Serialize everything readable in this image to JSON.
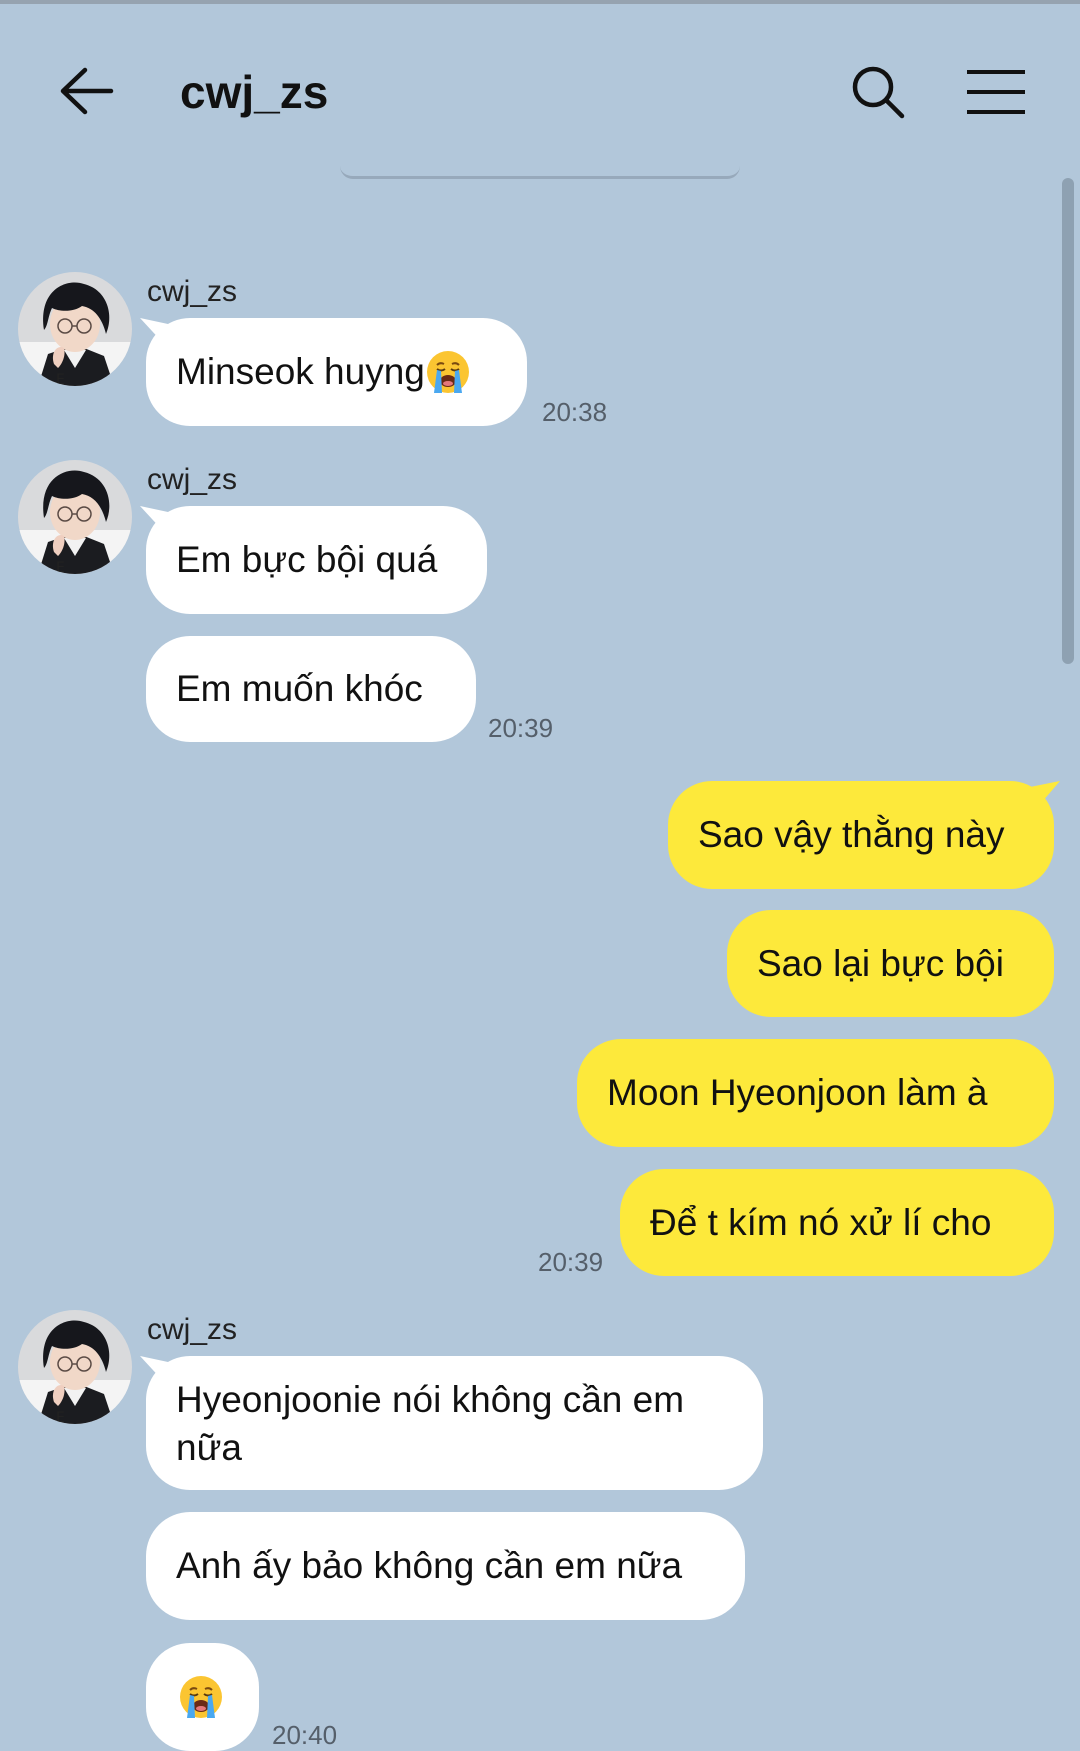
{
  "chat": {
    "title": "cwj_zs"
  },
  "messages": {
    "g1": {
      "sender": "cwj_zs",
      "m1": "Minseok huyng",
      "time": "20:38"
    },
    "g2": {
      "sender": "cwj_zs",
      "m1": "Em bực bội quá",
      "m2": "Em muốn khóc",
      "time": "20:39"
    },
    "g3": {
      "m1": "Sao vậy thằng này",
      "m2": "Sao lại bực bội",
      "m3": "Moon Hyeonjoon làm à",
      "m4": "Để t kím nó xử lí cho",
      "time": "20:39"
    },
    "g4": {
      "sender": "cwj_zs",
      "m1": "Hyeonjoonie nói không cần em nữa",
      "m2": "Anh ấy bảo không cần em nữa",
      "time": "20:40"
    }
  },
  "icons": {
    "back": "back-arrow-icon",
    "search": "search-icon",
    "menu": "hamburger-menu-icon",
    "emoji": "crying-face-emoji"
  },
  "colors": {
    "background": "#b2c7da",
    "incoming_bubble": "#ffffff",
    "outgoing_bubble": "#fde93b"
  }
}
